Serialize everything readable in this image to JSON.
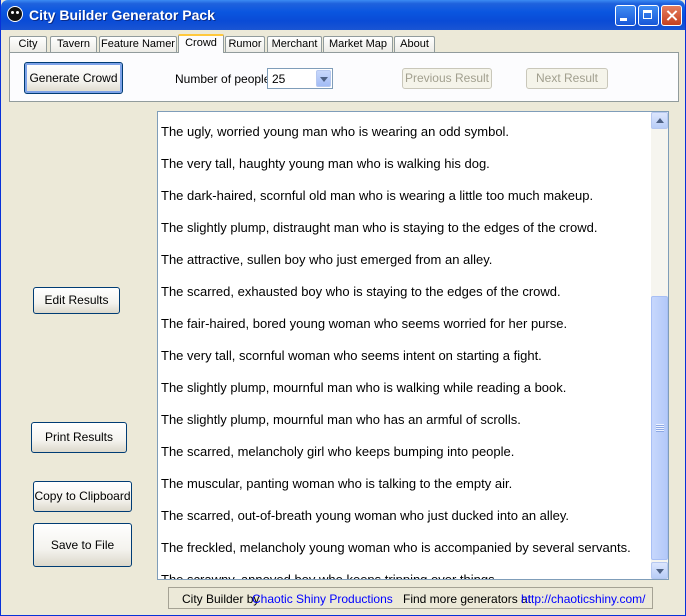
{
  "window": {
    "title": "City Builder Generator Pack"
  },
  "tabs": [
    {
      "label": "City"
    },
    {
      "label": "Tavern"
    },
    {
      "label": "Feature Namer"
    },
    {
      "label": "Crowd",
      "active": true
    },
    {
      "label": "Rumor"
    },
    {
      "label": "Merchant"
    },
    {
      "label": "Market Map"
    },
    {
      "label": "About"
    }
  ],
  "toolbar": {
    "generate_label": "Generate Crowd",
    "people_label": "Number of people:",
    "people_value": "25",
    "previous_label": "Previous Result",
    "next_label": "Next Result"
  },
  "side_buttons": {
    "edit": "Edit Results",
    "print": "Print Results",
    "copy": "Copy to Clipboard",
    "save": "Save to File"
  },
  "results": [
    "The ugly, worried young man who is wearing an odd symbol.",
    "The very tall, haughty young man who is walking his dog.",
    "The dark-haired, scornful old man who is wearing a little too much makeup.",
    "The slightly plump, distraught man who is staying to the edges of the crowd.",
    "The attractive, sullen boy who just emerged from an alley.",
    "The scarred, exhausted boy who is staying to the edges of the crowd.",
    "The fair-haired, bored young woman who seems worried for her purse.",
    "The very tall, scornful woman who seems intent on starting a fight.",
    "The slightly plump, mournful man who is walking while reading a book.",
    "The slightly plump, mournful man who has an armful of scrolls.",
    "The scarred, melancholy girl who keeps bumping into people.",
    "The muscular, panting woman who is talking to the empty air.",
    "The scarred, out-of-breath young woman who just ducked into an alley.",
    "The freckled, melancholy young woman who is accompanied by several servants.",
    "The scrawny, annoyed boy who keeps tripping over things."
  ],
  "status": {
    "credit_prefix": "City Builder by",
    "credit_link": "Chaotic Shiny Productions",
    "more_prefix": "Find more generators at",
    "more_link": "http://chaoticshiny.com/"
  }
}
